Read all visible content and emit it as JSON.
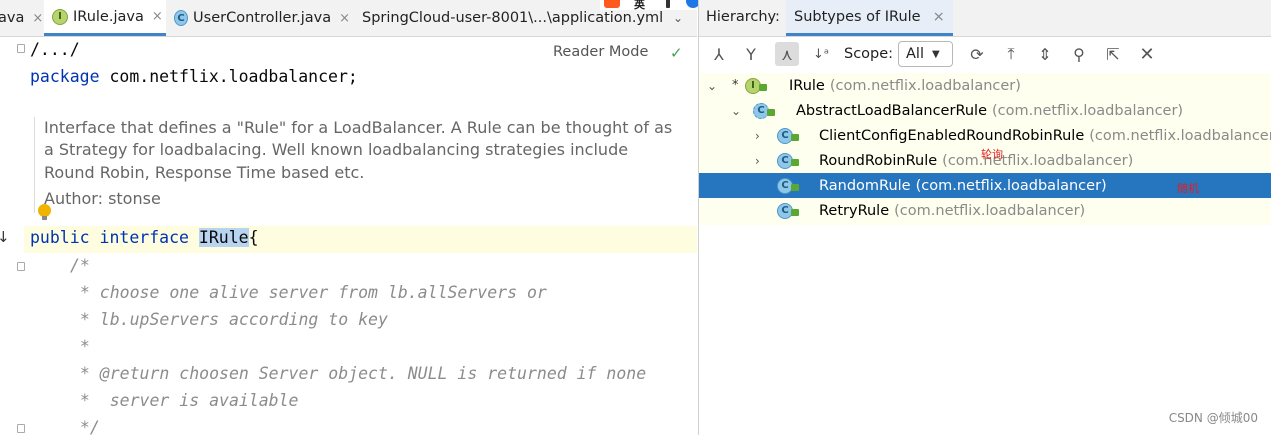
{
  "editor": {
    "tabs": [
      {
        "label": "ava",
        "icon": "none"
      },
      {
        "label": "IRule.java",
        "icon": "interface-icon"
      },
      {
        "label": "UserController.java",
        "icon": "class-icon"
      },
      {
        "label": "SpringCloud-user-8001\\...\\application.yml",
        "icon": "spring-leaf-icon"
      }
    ],
    "tab_close_glyph": "×",
    "reader_mode": "Reader Mode",
    "fold_line": "/.../",
    "package_kw": "package",
    "package_name": " com.netflix.loadbalancer;",
    "doc_text": "Interface that defines a \"Rule\" for a LoadBalancer. A Rule can be thought of as a Strategy for loadbalacing. Well known loadbalancing strategies include Round Robin, Response Time based etc.",
    "doc_author": "Author: stonse",
    "decl_kw1": "public",
    "decl_kw2": "interface",
    "decl_name": "IRule",
    "decl_brace": "{",
    "comment_lines": [
      "/*",
      " * choose one alive server from lb.allServers or",
      " * lb.upServers according to key",
      " *",
      " * @return choosen Server object. NULL is returned if none",
      " *  server is available",
      " */"
    ]
  },
  "hierarchy": {
    "title": "Hierarchy:",
    "tab_label": "Subtypes of IRule",
    "scope_label": "Scope:",
    "scope_value": "All",
    "toolbar_icons": [
      "supertypes-icon",
      "subtypes-icon",
      "class-hierarchy-icon",
      "sort-alpha-icon",
      "refresh-icon",
      "export-icon",
      "expand-all-icon",
      "pin-icon",
      "open-in-editor-icon",
      "close-icon"
    ],
    "tree": [
      {
        "name": "IRule",
        "pkg": "(com.netflix.loadbalancer)",
        "kind": "interface",
        "level": 0,
        "expanded": true,
        "star": true,
        "selected": false
      },
      {
        "name": "AbstractLoadBalancerRule",
        "pkg": "(com.netflix.loadbalancer)",
        "kind": "abstract-class",
        "level": 1,
        "expanded": true,
        "star": false,
        "selected": false
      },
      {
        "name": "ClientConfigEnabledRoundRobinRule",
        "pkg": "(com.netflix.loadbalancer)",
        "kind": "class",
        "level": 2,
        "expanded": false,
        "star": false,
        "selected": false
      },
      {
        "name": "RoundRobinRule",
        "pkg": "(com.netflix.loadbalancer)",
        "kind": "class",
        "level": 2,
        "expanded": false,
        "star": false,
        "selected": false
      },
      {
        "name": "RandomRule",
        "pkg": "(com.netflix.loadbalancer)",
        "kind": "class",
        "level": 2,
        "expanded": null,
        "star": false,
        "selected": true
      },
      {
        "name": "RetryRule",
        "pkg": "(com.netflix.loadbalancer)",
        "kind": "class",
        "level": 2,
        "expanded": null,
        "star": false,
        "selected": false
      }
    ],
    "annotations": [
      "轮询",
      "随机"
    ]
  },
  "ime_toolbar": {
    "label": "英"
  },
  "watermark": "CSDN @倾城00",
  "colors": {
    "selection": "#2675bf",
    "tab_underline": "#4083c9",
    "keyword": "#0033b3",
    "annotation": "#e02020"
  }
}
